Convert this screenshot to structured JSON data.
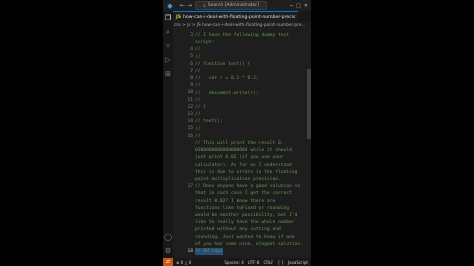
{
  "titlebar": {
    "search_text": "Search [Administrator]",
    "nav_back": "←",
    "nav_forward": "→"
  },
  "tab": {
    "icon_text": "JS",
    "label": "how-can-i-deal-with-floating-point-number-precis",
    "close": "×"
  },
  "breadcrumb": {
    "text": "cro > js > JS how-can-i-deal-with-floating-point-number-pre..."
  },
  "editor": {
    "lines": [
      {
        "n": "",
        "text": "// I have the following dummy test"
      },
      {
        "n": "",
        "text": "script:"
      },
      {
        "n": "",
        "text": "//"
      },
      {
        "n": "",
        "text": "//"
      },
      {
        "n": "",
        "text": "// function test() {"
      },
      {
        "n": "",
        "text": "//"
      },
      {
        "n": "",
        "text": "//   var r = 0.1 * 0.2;"
      },
      {
        "n": "",
        "text": "//"
      },
      {
        "n": "",
        "text": "//   document.write(r);"
      },
      {
        "n": "",
        "text": "//"
      },
      {
        "n": "",
        "text": "// }"
      },
      {
        "n": "",
        "text": "//"
      },
      {
        "n": "",
        "text": "// test();"
      },
      {
        "n": "",
        "text": "//"
      },
      {
        "n": "",
        "text": "//"
      },
      {
        "n": "",
        "text": "// This will print the result 0."
      },
      {
        "n": "",
        "text": "0300000000000000004 while it should"
      },
      {
        "n": "",
        "text": "just print 0.02 (if you use your"
      },
      {
        "n": "",
        "text": "calculator). As far as I understood"
      },
      {
        "n": "",
        "text": "this is due to errors in the floating"
      },
      {
        "n": "",
        "text": "point multiplication precision."
      },
      {
        "n": "",
        "text": "// Does anyone have a good solution so"
      },
      {
        "n": "",
        "text": "that in such case I get the correct"
      },
      {
        "n": "",
        "text": "result 0.02? I know there are"
      },
      {
        "n": "",
        "text": "functions like toFixed or rounding"
      },
      {
        "n": "",
        "text": "would be another possibility, but I'd"
      },
      {
        "n": "",
        "text": "like to really have the whole number"
      },
      {
        "n": "",
        "text": "printed without any cutting and"
      },
      {
        "n": "",
        "text": "rounding. Just wanted to know if one"
      },
      {
        "n": "",
        "text": "of you has some nice, elegant solution."
      },
      {
        "n": "",
        "text": "// GH copi"
      }
    ],
    "line_numbers": [
      {
        "label": "3",
        "row": 0
      },
      {
        "label": "4",
        "row": 2
      },
      {
        "label": "5",
        "row": 3
      },
      {
        "label": "6",
        "row": 4
      },
      {
        "label": "7",
        "row": 5
      },
      {
        "label": "8",
        "row": 6
      },
      {
        "label": "9",
        "row": 7
      },
      {
        "label": "10",
        "row": 8
      },
      {
        "label": "11",
        "row": 9
      },
      {
        "label": "12",
        "row": 10
      },
      {
        "label": "13",
        "row": 11
      },
      {
        "label": "14",
        "row": 12
      },
      {
        "label": "15",
        "row": 13
      },
      {
        "label": "16",
        "row": 14
      },
      {
        "label": "17",
        "row": 21
      },
      {
        "label": "18",
        "row": 30
      }
    ]
  },
  "statusbar": {
    "remote_icon": "⇄",
    "errors": "⊗ 0 △ 0",
    "spaces": "Spaces: 4",
    "encoding": "UTF-8",
    "eol": "CRLF",
    "braces": "{ }",
    "language": "JavaScript"
  },
  "colors": {
    "comment": "#6a9955",
    "selection": "#264f78",
    "accent": "#0078d4",
    "remote": "#c85a10"
  }
}
